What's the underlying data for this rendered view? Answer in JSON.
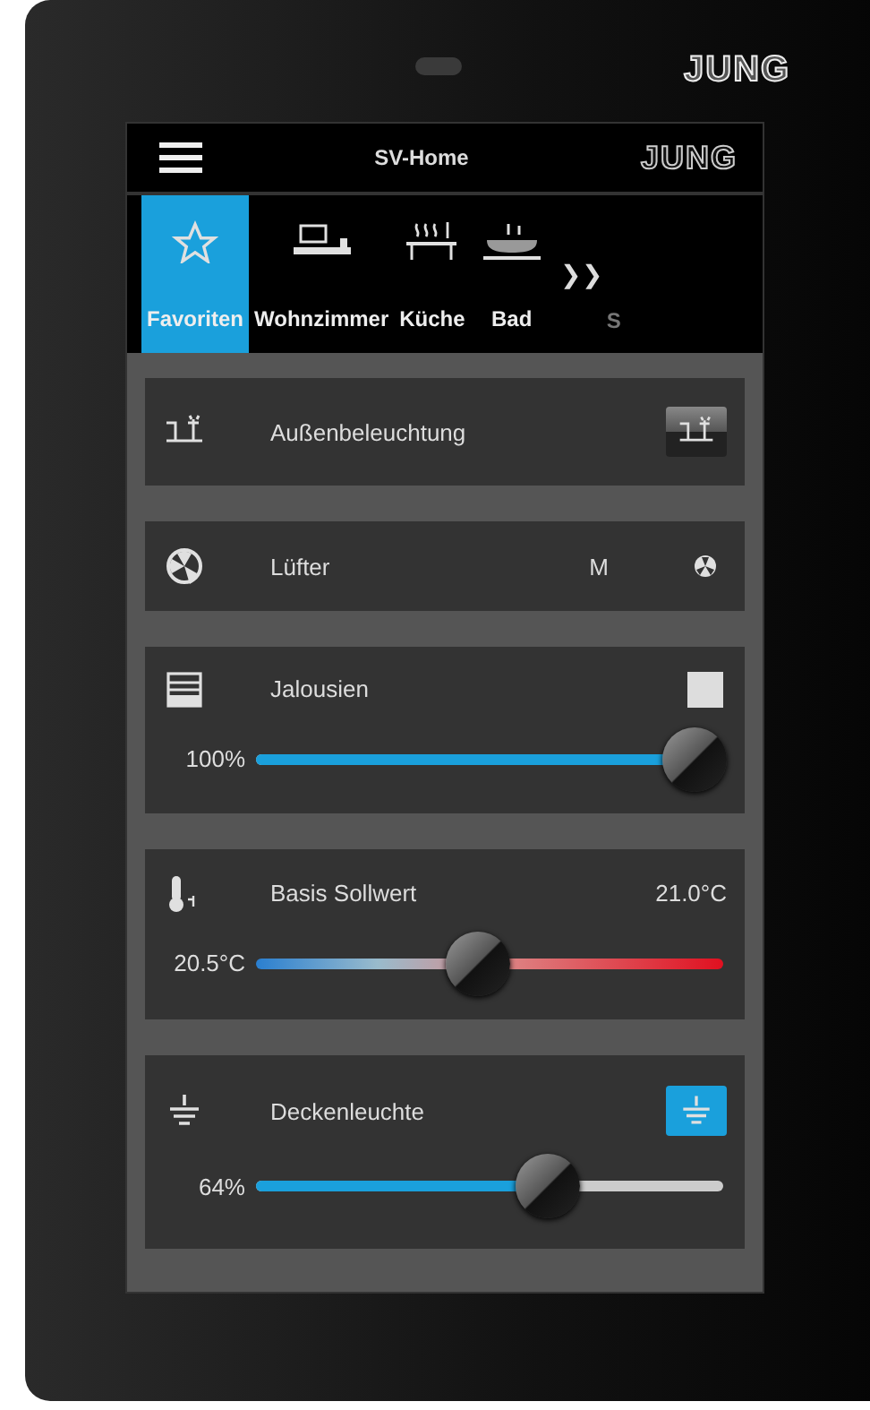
{
  "device": {
    "logo": "JUNG"
  },
  "header": {
    "title": "SV-Home",
    "logo": "JUNG"
  },
  "tabs": [
    {
      "label": "Favoriten",
      "selected": true
    },
    {
      "label": "Wohnzimmer",
      "selected": false
    },
    {
      "label": "Küche",
      "selected": false
    },
    {
      "label": "Bad",
      "selected": false
    }
  ],
  "tabs_more": {
    "arrow": "❯❯",
    "partial_label": "S"
  },
  "cards": [
    {
      "kind": "switch",
      "label": "Außenbeleuchtung",
      "on": false
    },
    {
      "kind": "fan",
      "label": "Lüfter",
      "mode": "M"
    },
    {
      "kind": "blind",
      "label": "Jalousien",
      "reading": "100%",
      "level": 1
    },
    {
      "kind": "setpoint",
      "label": "Basis Sollwert",
      "value": "21.0°C",
      "reading": "20.5°C",
      "level": 0.47
    },
    {
      "kind": "dimmer",
      "label": "Deckenleuchte",
      "on": true,
      "reading": "64%",
      "level": 0.64
    }
  ]
}
